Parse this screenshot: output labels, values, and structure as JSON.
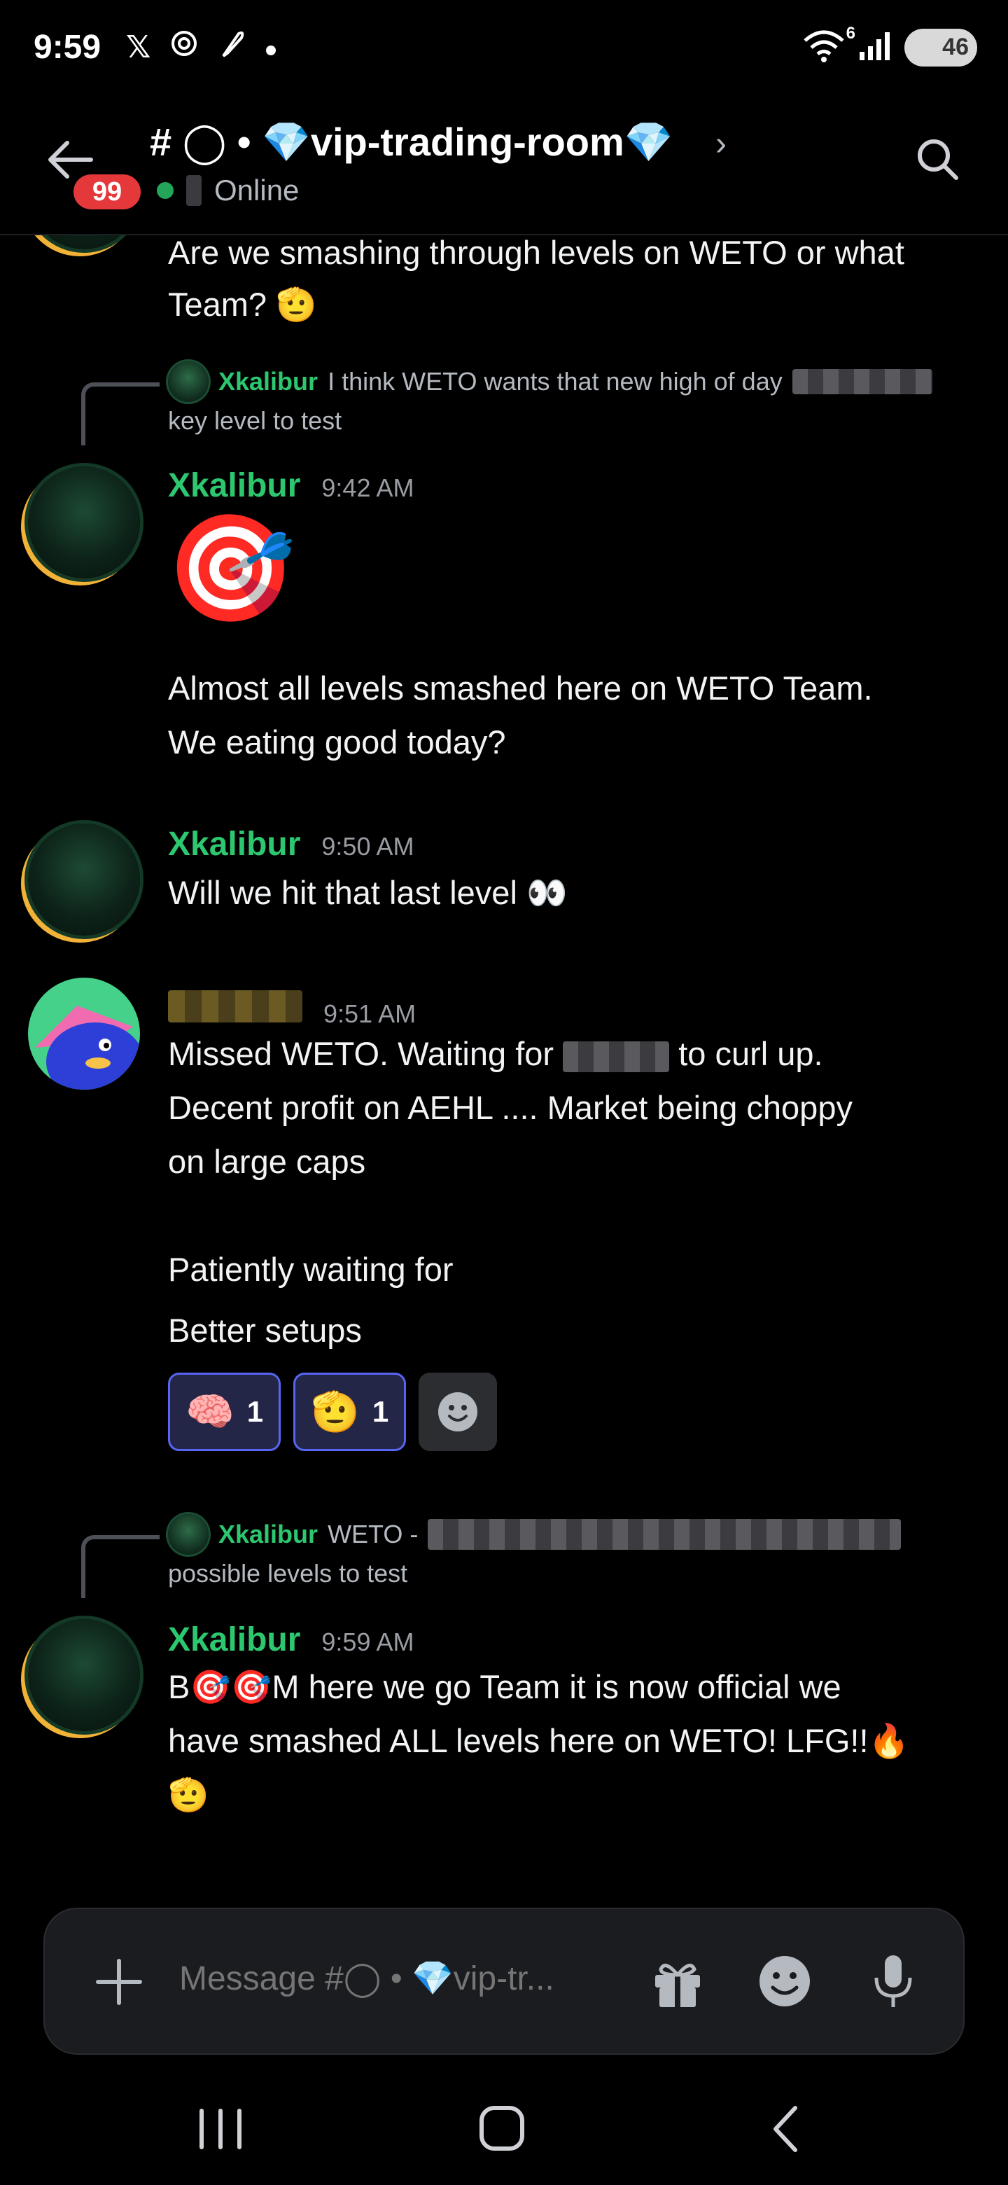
{
  "status_bar": {
    "time": "9:59",
    "battery": "46",
    "wifi_label": "6",
    "icons_left": [
      "x-logo-icon",
      "openai-icon",
      "feather-icon",
      "dot-icon"
    ],
    "icons_right": [
      "wifi-icon",
      "signal-icon",
      "battery-icon"
    ]
  },
  "header": {
    "unread_count": "99",
    "channel_name": "# ◯ • 💎vip-trading-room💎",
    "chevron": "›",
    "presence_label": "Online",
    "presence_color": "#23a55a"
  },
  "messages": {
    "partial": {
      "line1": "Are we smashing through levels on WETO or what",
      "line2": "Team? 🫡"
    },
    "reply1": {
      "author": "Xkalibur",
      "text": "I think WETO wants that new high of day",
      "cont": "key level to test"
    },
    "msg1": {
      "author": "Xkalibur",
      "time": "9:42 AM",
      "emoji": "🎯",
      "line1": "Almost all levels smashed here on WETO Team.",
      "line2": "We eating good today?"
    },
    "msg2": {
      "author": "Xkalibur",
      "time": "9:50 AM",
      "text": "Will we hit that last level 👀"
    },
    "msg3": {
      "time": "9:51 AM",
      "line1a": "Missed WETO. Waiting for",
      "line1b": "to curl up.",
      "line2": "Decent profit on AEHL ....  Market being choppy",
      "line3": "on large caps",
      "line4": "Patiently waiting for",
      "line5": "Better setups",
      "reactions": [
        {
          "emoji": "🧠",
          "count": "1"
        },
        {
          "emoji": "🫡",
          "count": "1"
        }
      ]
    },
    "reply2": {
      "author": "Xkalibur",
      "text": "WETO -",
      "cont": "possible levels to test"
    },
    "msg4": {
      "author": "Xkalibur",
      "time": "9:59 AM",
      "line1": "B🎯🎯M here we go Team it is now official we",
      "line2": "have smashed ALL levels here on WETO! LFG!!🔥",
      "line3": "🫡"
    }
  },
  "composer": {
    "placeholder": "Message #◯ • 💎vip-tr..."
  },
  "colors": {
    "author_green": "#2dc770",
    "author_gold": "#f0b132",
    "reaction_border": "#5865f2",
    "unread_badge": "#e5383b"
  }
}
